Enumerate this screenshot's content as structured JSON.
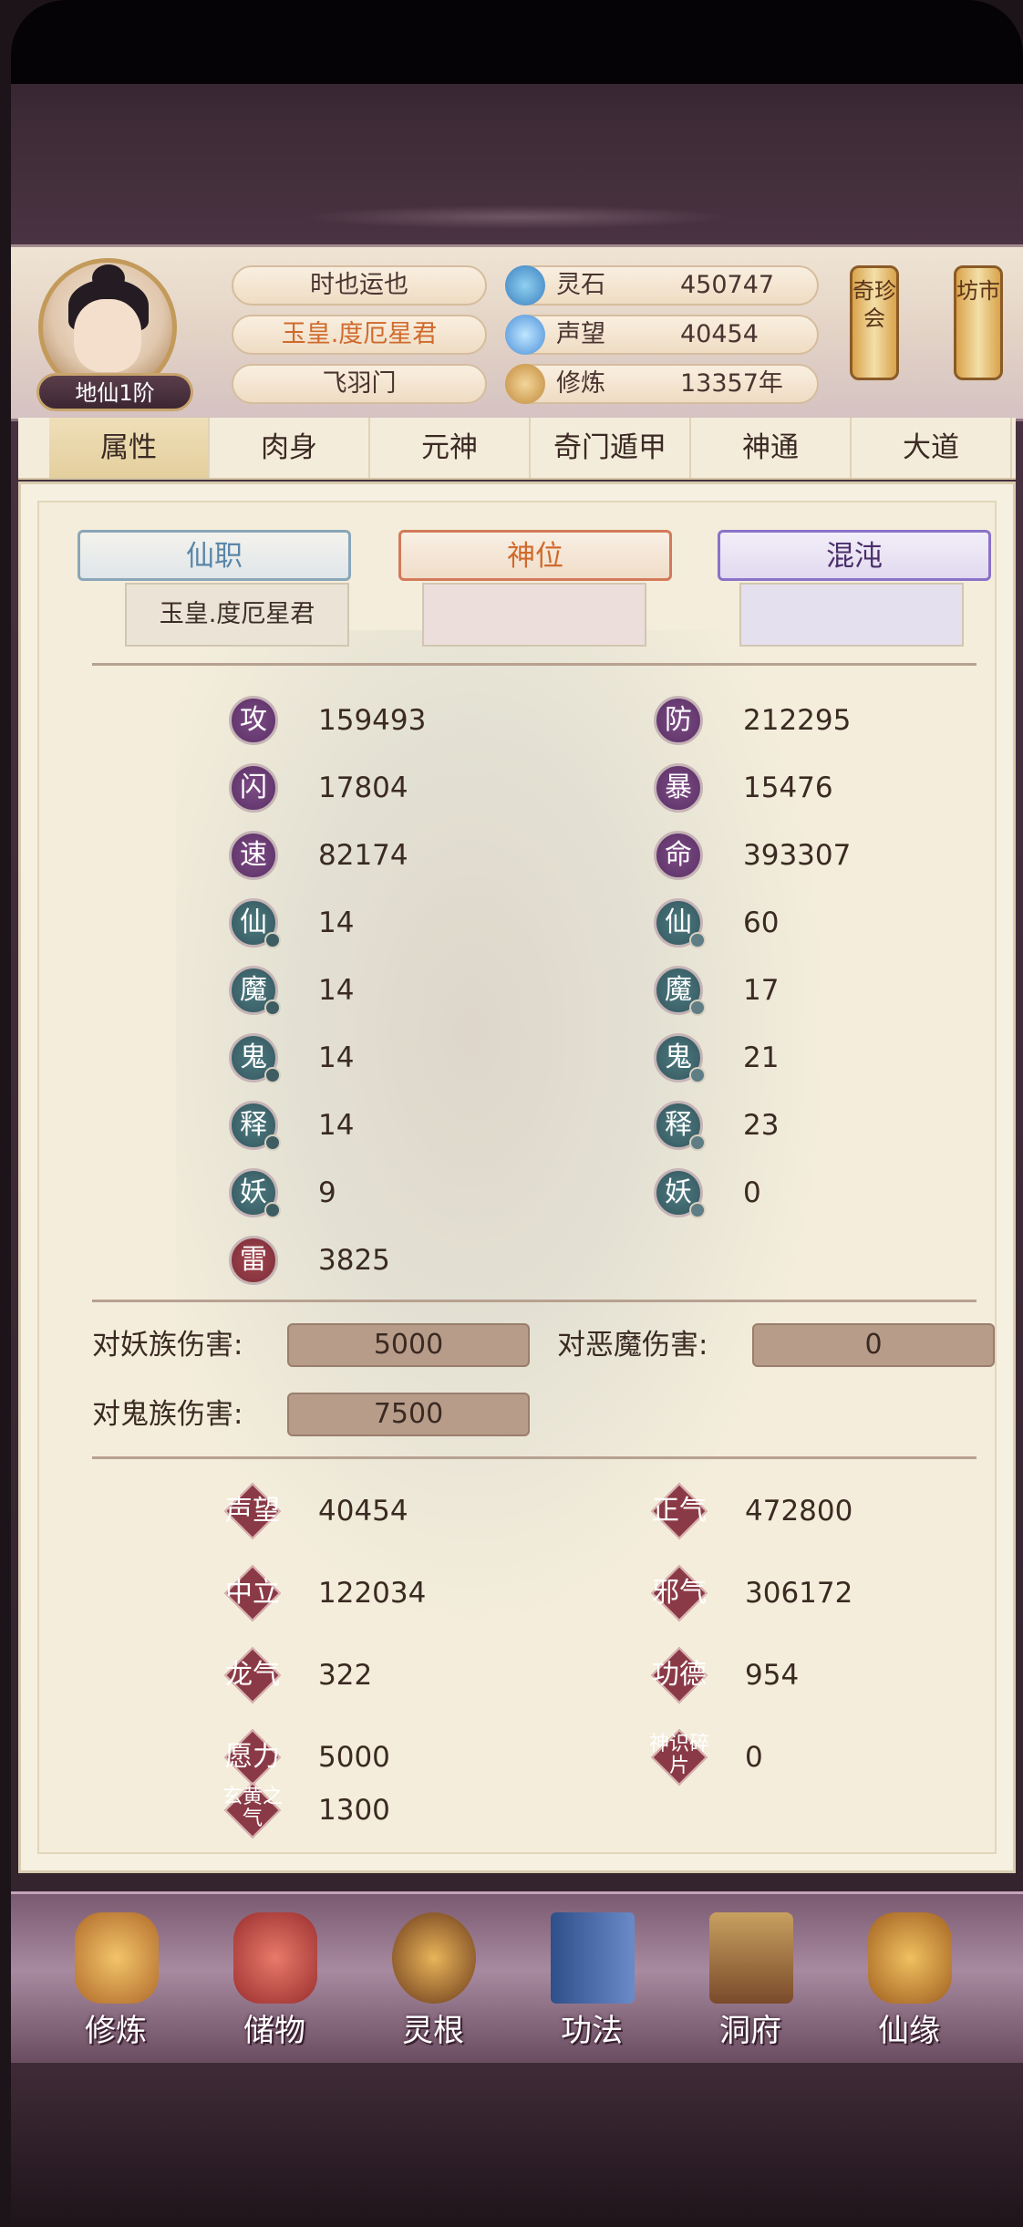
{
  "player": {
    "level": "地仙1阶",
    "title": "时也运也",
    "rank": "玉皇.度厄星君",
    "sect": "飞羽门"
  },
  "resources": [
    {
      "label": "灵石",
      "value": "450747",
      "icon": "spirit-stone-icon"
    },
    {
      "label": "声望",
      "value": "40454",
      "icon": "reputation-icon"
    },
    {
      "label": "修炼",
      "value": "13357年",
      "icon": "cultivation-icon"
    }
  ],
  "side_buttons": [
    {
      "label": "奇珍会"
    },
    {
      "label": "坊市"
    }
  ],
  "tabs": [
    "属性",
    "肉身",
    "元神",
    "奇门遁甲",
    "神通",
    "大道"
  ],
  "active_tab": "属性",
  "positions": {
    "xianzhi": {
      "label": "仙职",
      "value": "玉皇.度厄星君"
    },
    "shenwei": {
      "label": "神位",
      "value": ""
    },
    "hundun": {
      "label": "混沌",
      "value": ""
    }
  },
  "stats_left": [
    {
      "badge": "攻",
      "value": "159493"
    },
    {
      "badge": "闪",
      "value": "17804"
    },
    {
      "badge": "速",
      "value": "82174"
    },
    {
      "badge": "仙",
      "value": "14"
    },
    {
      "badge": "魔",
      "value": "14"
    },
    {
      "badge": "鬼",
      "value": "14"
    },
    {
      "badge": "释",
      "value": "14"
    },
    {
      "badge": "妖",
      "value": "9"
    },
    {
      "badge": "雷",
      "value": "3825"
    }
  ],
  "stats_right": [
    {
      "badge": "防",
      "value": "212295"
    },
    {
      "badge": "暴",
      "value": "15476"
    },
    {
      "badge": "命",
      "value": "393307"
    },
    {
      "badge": "仙",
      "value": "60"
    },
    {
      "badge": "魔",
      "value": "17"
    },
    {
      "badge": "鬼",
      "value": "21"
    },
    {
      "badge": "释",
      "value": "23"
    },
    {
      "badge": "妖",
      "value": "0"
    }
  ],
  "damage": [
    {
      "label": "对妖族伤害:",
      "value": "5000"
    },
    {
      "label": "对恶魔伤害:",
      "value": "0"
    },
    {
      "label": "对鬼族伤害:",
      "value": "7500"
    }
  ],
  "attrs_left": [
    {
      "label": "声望",
      "value": "40454"
    },
    {
      "label": "中立",
      "value": "122034"
    },
    {
      "label": "龙气",
      "value": "322"
    },
    {
      "label": "愿力",
      "value": "5000"
    },
    {
      "label": "玄黄之气",
      "value": "1300"
    }
  ],
  "attrs_right": [
    {
      "label": "正气",
      "value": "472800"
    },
    {
      "label": "邪气",
      "value": "306172"
    },
    {
      "label": "功德",
      "value": "954"
    },
    {
      "label": "神识碎片",
      "value": "0"
    }
  ],
  "bottom_nav": [
    {
      "label": "修炼",
      "icon": "meditating-monk-icon"
    },
    {
      "label": "储物",
      "icon": "storage-bag-icon"
    },
    {
      "label": "灵根",
      "icon": "spirit-root-icon"
    },
    {
      "label": "功法",
      "icon": "scripture-book-icon"
    },
    {
      "label": "洞府",
      "icon": "cave-residence-icon"
    },
    {
      "label": "仙缘",
      "icon": "gourd-icon"
    }
  ],
  "colors": {
    "accent_orange": "#d06a2c",
    "badge_purple": "#6a3a75",
    "badge_teal": "#3e656b",
    "badge_red": "#8a3a46",
    "panel_bg": "#f4eddb"
  }
}
